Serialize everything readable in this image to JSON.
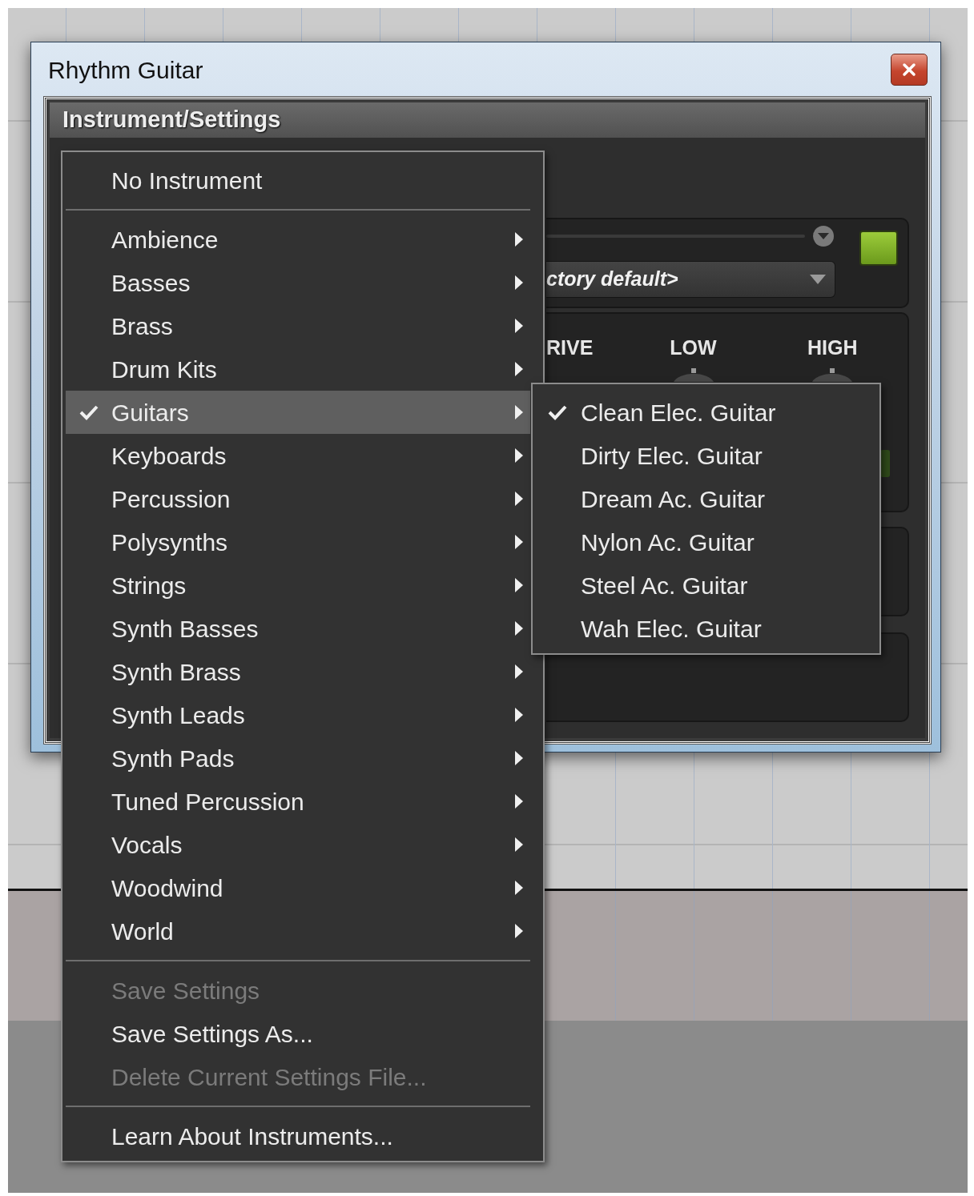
{
  "window": {
    "title": "Rhythm Guitar"
  },
  "panel": {
    "title": "Instrument/Settings",
    "preset": "ctory default>",
    "knob_labels": [
      "RIVE",
      "LOW",
      "HIGH"
    ]
  },
  "menu": {
    "items": [
      {
        "kind": "item",
        "label": "No Instrument",
        "checked": false,
        "selected": false,
        "disabled": false,
        "submenu": false
      },
      {
        "kind": "separator"
      },
      {
        "kind": "item",
        "label": "Ambience",
        "checked": false,
        "selected": false,
        "disabled": false,
        "submenu": true
      },
      {
        "kind": "item",
        "label": "Basses",
        "checked": false,
        "selected": false,
        "disabled": false,
        "submenu": true
      },
      {
        "kind": "item",
        "label": "Brass",
        "checked": false,
        "selected": false,
        "disabled": false,
        "submenu": true
      },
      {
        "kind": "item",
        "label": "Drum Kits",
        "checked": false,
        "selected": false,
        "disabled": false,
        "submenu": true
      },
      {
        "kind": "item",
        "label": "Guitars",
        "checked": true,
        "selected": true,
        "disabled": false,
        "submenu": true
      },
      {
        "kind": "item",
        "label": "Keyboards",
        "checked": false,
        "selected": false,
        "disabled": false,
        "submenu": true
      },
      {
        "kind": "item",
        "label": "Percussion",
        "checked": false,
        "selected": false,
        "disabled": false,
        "submenu": true
      },
      {
        "kind": "item",
        "label": "Polysynths",
        "checked": false,
        "selected": false,
        "disabled": false,
        "submenu": true
      },
      {
        "kind": "item",
        "label": "Strings",
        "checked": false,
        "selected": false,
        "disabled": false,
        "submenu": true
      },
      {
        "kind": "item",
        "label": "Synth Basses",
        "checked": false,
        "selected": false,
        "disabled": false,
        "submenu": true
      },
      {
        "kind": "item",
        "label": "Synth Brass",
        "checked": false,
        "selected": false,
        "disabled": false,
        "submenu": true
      },
      {
        "kind": "item",
        "label": "Synth Leads",
        "checked": false,
        "selected": false,
        "disabled": false,
        "submenu": true
      },
      {
        "kind": "item",
        "label": "Synth Pads",
        "checked": false,
        "selected": false,
        "disabled": false,
        "submenu": true
      },
      {
        "kind": "item",
        "label": "Tuned Percussion",
        "checked": false,
        "selected": false,
        "disabled": false,
        "submenu": true
      },
      {
        "kind": "item",
        "label": "Vocals",
        "checked": false,
        "selected": false,
        "disabled": false,
        "submenu": true
      },
      {
        "kind": "item",
        "label": "Woodwind",
        "checked": false,
        "selected": false,
        "disabled": false,
        "submenu": true
      },
      {
        "kind": "item",
        "label": "World",
        "checked": false,
        "selected": false,
        "disabled": false,
        "submenu": true
      },
      {
        "kind": "separator"
      },
      {
        "kind": "item",
        "label": "Save Settings",
        "checked": false,
        "selected": false,
        "disabled": true,
        "submenu": false
      },
      {
        "kind": "item",
        "label": "Save Settings As...",
        "checked": false,
        "selected": false,
        "disabled": false,
        "submenu": false
      },
      {
        "kind": "item",
        "label": "Delete Current Settings File...",
        "checked": false,
        "selected": false,
        "disabled": true,
        "submenu": false
      },
      {
        "kind": "separator"
      },
      {
        "kind": "item",
        "label": "Learn About Instruments...",
        "checked": false,
        "selected": false,
        "disabled": false,
        "submenu": false
      }
    ]
  },
  "submenu": {
    "items": [
      {
        "kind": "item",
        "label": "Clean Elec. Guitar",
        "checked": true,
        "selected": false,
        "disabled": false,
        "submenu": false
      },
      {
        "kind": "item",
        "label": "Dirty Elec. Guitar",
        "checked": false,
        "selected": false,
        "disabled": false,
        "submenu": false
      },
      {
        "kind": "item",
        "label": "Dream Ac. Guitar",
        "checked": false,
        "selected": false,
        "disabled": false,
        "submenu": false
      },
      {
        "kind": "item",
        "label": "Nylon Ac. Guitar",
        "checked": false,
        "selected": false,
        "disabled": false,
        "submenu": false
      },
      {
        "kind": "item",
        "label": "Steel Ac. Guitar",
        "checked": false,
        "selected": false,
        "disabled": false,
        "submenu": false
      },
      {
        "kind": "item",
        "label": "Wah Elec. Guitar",
        "checked": false,
        "selected": false,
        "disabled": false,
        "submenu": false
      }
    ]
  }
}
